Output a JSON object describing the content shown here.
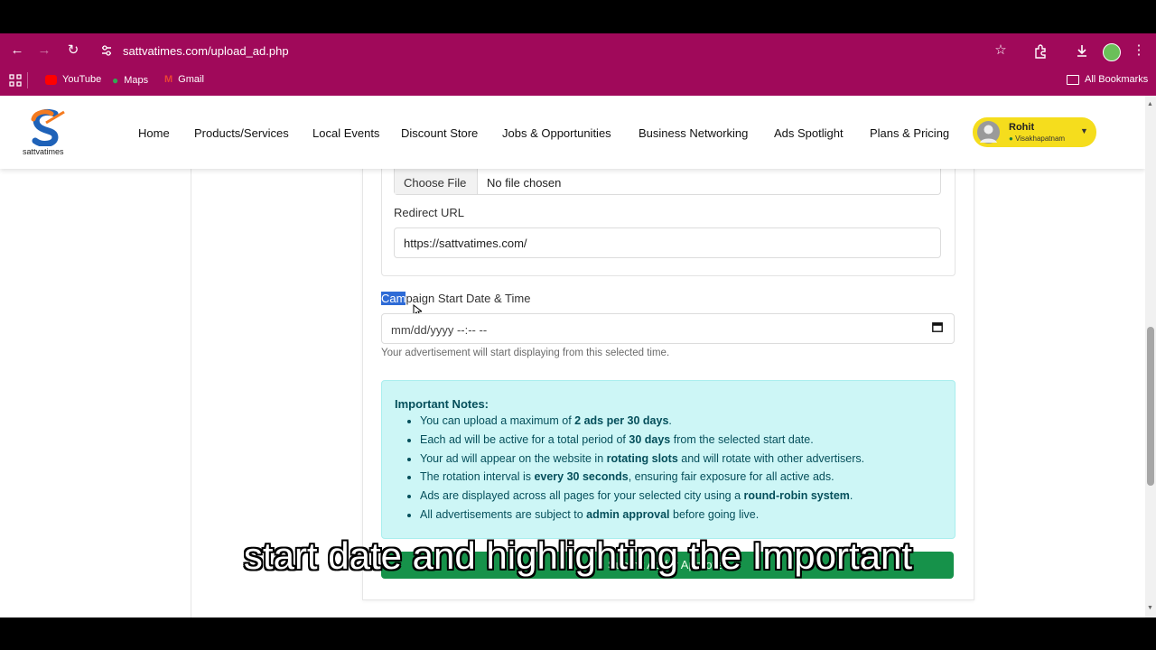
{
  "browser": {
    "url": "sattvatimes.com/upload_ad.php",
    "bookmarks": [
      {
        "label": "YouTube",
        "icon": "youtube-icon",
        "color": "#ff0000"
      },
      {
        "label": "Maps",
        "icon": "maps-pin-icon",
        "color": "#34a853"
      },
      {
        "label": "Gmail",
        "icon": "gmail-icon",
        "color": "#ea4335"
      }
    ],
    "all_bookmarks": "All Bookmarks",
    "chrome_color": "#a0095a"
  },
  "site": {
    "logo_text": "sattvatimes",
    "menu": [
      "Home",
      "Products/Services",
      "Local Events",
      "Discount Store",
      "Jobs & Opportunities",
      "Business Networking",
      "Ads Spotlight",
      "Plans & Pricing"
    ],
    "user": {
      "name": "Rohit",
      "location": "Visakhapatnam"
    }
  },
  "form": {
    "choose_file_button": "Choose File",
    "file_status": "No file chosen",
    "redirect_label": "Redirect URL",
    "redirect_value": "https://sattvatimes.com/",
    "campaign_label_selected": "Cam",
    "campaign_label_rest": "paign Start Date & Time",
    "datetime_placeholder": "mm/dd/yyyy --:-- --",
    "datetime_help": "Your advertisement will start displaying from this selected time.",
    "submit_label": "Submit Ad for Approval"
  },
  "notes": {
    "title": "Important Notes:",
    "items": [
      {
        "pre": "You can upload a maximum of ",
        "bold": "2 ads per 30 days",
        "post": "."
      },
      {
        "pre": "Each ad will be active for a total period of ",
        "bold": "30 days",
        "post": " from the selected start date."
      },
      {
        "pre": "Your ad will appear on the website in ",
        "bold": "rotating slots",
        "post": " and will rotate with other advertisers."
      },
      {
        "pre": "The rotation interval is ",
        "bold": "every 30 seconds",
        "post": ", ensuring fair exposure for all active ads."
      },
      {
        "pre": "Ads are displayed across all pages for your selected city using a ",
        "bold": "round-robin system",
        "post": "."
      },
      {
        "pre": "All advertisements are subject to ",
        "bold": "admin approval",
        "post": " before going live."
      }
    ]
  },
  "caption": "start date and highlighting the Important"
}
